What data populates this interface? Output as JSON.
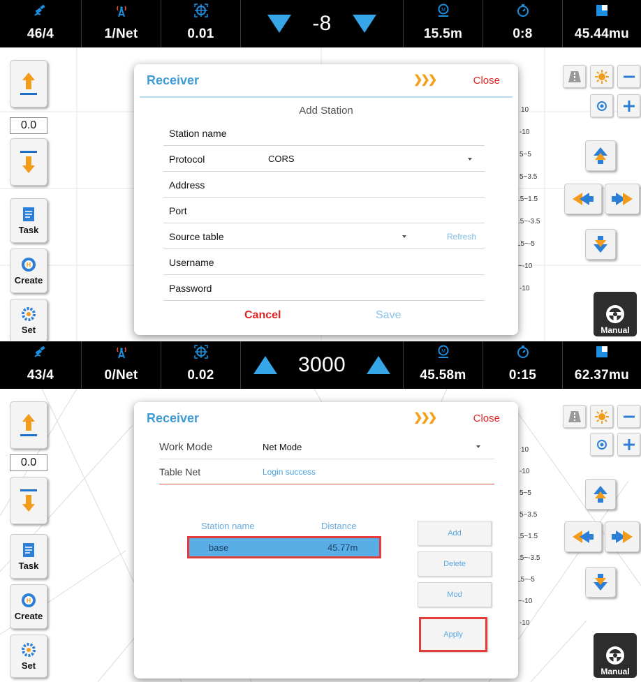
{
  "top": {
    "status": {
      "satellites": "46/4",
      "network": "1/Net",
      "precision": "0.01",
      "offset": "-8",
      "distance": "15.5m",
      "time": "0:8",
      "area": "45.44mu"
    },
    "left_toolbar": {
      "offset_value": "0.0",
      "task_label": "Task",
      "create_label": "Create",
      "set_label": "Set"
    },
    "manual_label": "Manual",
    "zone_labels": [
      "10",
      "-10",
      "5~5",
      "5~3.5",
      ".5~1.5",
      ".5~-3.5",
      "L5~-5",
      "~-10",
      "-10"
    ],
    "dialog": {
      "title": "Receiver",
      "arrows": "❯❯❯",
      "close": "Close",
      "subtitle": "Add Station",
      "fields": [
        {
          "label": "Station name",
          "value": ""
        },
        {
          "label": "Protocol",
          "value": "CORS",
          "dropdown": true
        },
        {
          "label": "Address",
          "value": ""
        },
        {
          "label": "Port",
          "value": ""
        },
        {
          "label": "Source table",
          "value": "",
          "dropdown": true,
          "action": "Refresh"
        },
        {
          "label": "Username",
          "value": ""
        },
        {
          "label": "Password",
          "value": ""
        }
      ],
      "cancel": "Cancel",
      "save": "Save"
    }
  },
  "bottom": {
    "status": {
      "satellites": "43/4",
      "network": "0/Net",
      "precision": "0.02",
      "offset": "3000",
      "distance": "45.58m",
      "time": "0:15",
      "area": "62.37mu"
    },
    "left_toolbar": {
      "offset_value": "0.0",
      "task_label": "Task",
      "create_label": "Create",
      "set_label": "Set"
    },
    "manual_label": "Manual",
    "zone_labels": [
      "10",
      "-10",
      "5~5",
      "5~3.5",
      ".5~1.5",
      ".5~-3.5",
      "L5~-5",
      "~-10",
      "-10"
    ],
    "dialog": {
      "title": "Receiver",
      "arrows": "❯❯❯",
      "close": "Close",
      "work_mode_label": "Work Mode",
      "work_mode_value": "Net Mode",
      "table_net_label": "Table Net",
      "table_net_value": "Login success",
      "table_headers": {
        "station": "Station name",
        "distance": "Distance"
      },
      "stations": [
        {
          "name": "base",
          "distance": "45.77m"
        }
      ],
      "buttons": {
        "add": "Add",
        "delete": "Delete",
        "mod": "Mod",
        "apply": "Apply"
      }
    }
  },
  "colors": {
    "accent_blue": "#3f9bd6",
    "close_red": "#e02424",
    "orange": "#f3a01b",
    "highlight_red": "#e23c3c",
    "selected_row": "#5aaee6"
  }
}
